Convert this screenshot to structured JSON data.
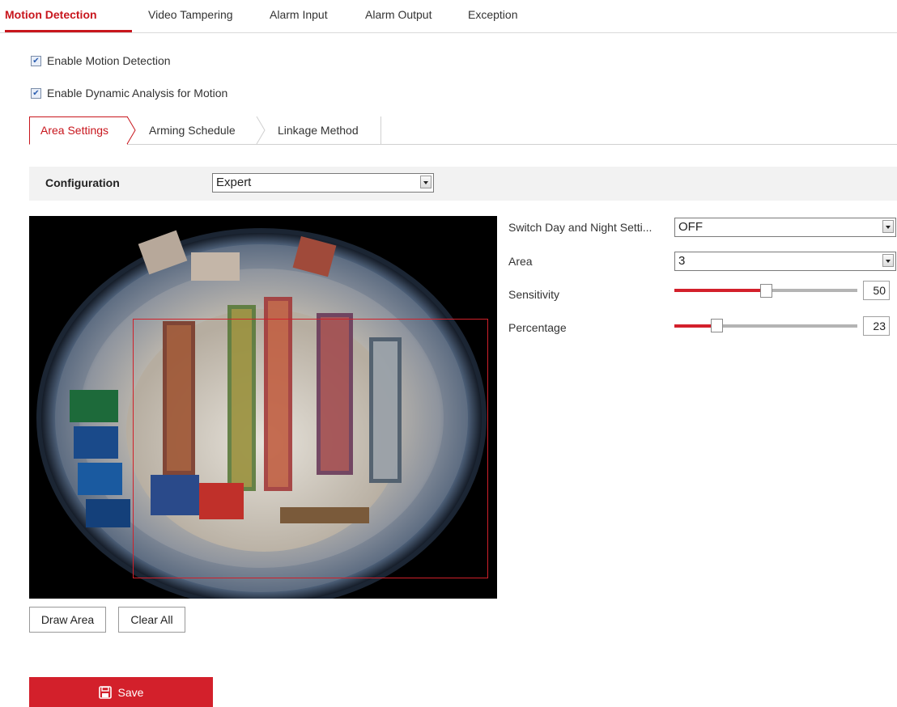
{
  "top_tabs": [
    {
      "label": "Motion Detection",
      "active": true
    },
    {
      "label": "Video Tampering",
      "active": false
    },
    {
      "label": "Alarm Input",
      "active": false
    },
    {
      "label": "Alarm Output",
      "active": false
    },
    {
      "label": "Exception",
      "active": false
    }
  ],
  "checkboxes": {
    "enable_motion": {
      "label": "Enable Motion Detection",
      "checked": true
    },
    "enable_dynamic": {
      "label": "Enable Dynamic Analysis for Motion",
      "checked": true
    }
  },
  "sub_tabs": [
    {
      "label": "Area Settings",
      "active": true
    },
    {
      "label": "Arming Schedule",
      "active": false
    },
    {
      "label": "Linkage Method",
      "active": false
    }
  ],
  "configuration": {
    "label": "Configuration",
    "value": "Expert"
  },
  "settings": {
    "switch_day_night": {
      "label": "Switch Day and Night Setti...",
      "value": "OFF"
    },
    "area": {
      "label": "Area",
      "value": "3"
    },
    "sensitivity": {
      "label": "Sensitivity",
      "value": "50"
    },
    "percentage": {
      "label": "Percentage",
      "value": "23"
    }
  },
  "buttons": {
    "draw_area": "Draw Area",
    "clear_all": "Clear All",
    "save": "Save"
  },
  "colors": {
    "accent": "#c8161d",
    "save_bg": "#d3202b",
    "region": "#d0202a"
  },
  "icons": {
    "save": "floppy-disk-icon",
    "checkbox": "checkmark-icon",
    "dropdown": "chevron-down-icon"
  }
}
